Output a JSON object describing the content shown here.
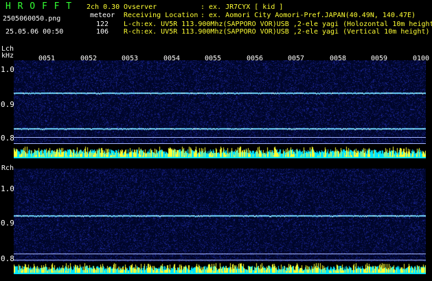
{
  "header": {
    "app_name": "H R O F F T",
    "channels_version": "2ch 0.30",
    "mode": "meteor",
    "filename": "2505060050.png",
    "datetime": "25.05.06 00:50",
    "count_l": "122",
    "count_r": "106",
    "observer_label": "Ovserver",
    "observer_value": ": ex. JR7CYX [ kid ]",
    "location_label": "Receiving Location",
    "location_value": ": ex. Aomori City Aomori-Pref.JAPAN(40.49N, 140.47E)",
    "lch_info": "L-ch:ex. UV5R 113.900Mhz(SAPPORO VOR)USB ,2-ele yagi (Holozontal 10m height)",
    "rch_info": "R-ch:ex. UV5R 113.900Mhz(SAPPORO VOR)USB ,2-ele yagi (Vertical 10m height)"
  },
  "lch": {
    "label": "Lch",
    "unit": "kHz",
    "y_ticks": [
      "1.0",
      "0.9",
      "0.8"
    ]
  },
  "rch": {
    "label": "Rch",
    "y_ticks": [
      "1.0",
      "0.9",
      "0.8"
    ]
  },
  "time_ticks": [
    "0051",
    "0052",
    "0053",
    "0054",
    "0055",
    "0056",
    "0057",
    "0058",
    "0059",
    "0100"
  ],
  "colors": {
    "title": "#33ff33",
    "meta": "#ffff33",
    "spectrogram_bg": "#00062a",
    "carrier_line": "#6fd8ff",
    "bar_cyan": "#00e5ff",
    "bar_yellow": "#ffff33"
  }
}
